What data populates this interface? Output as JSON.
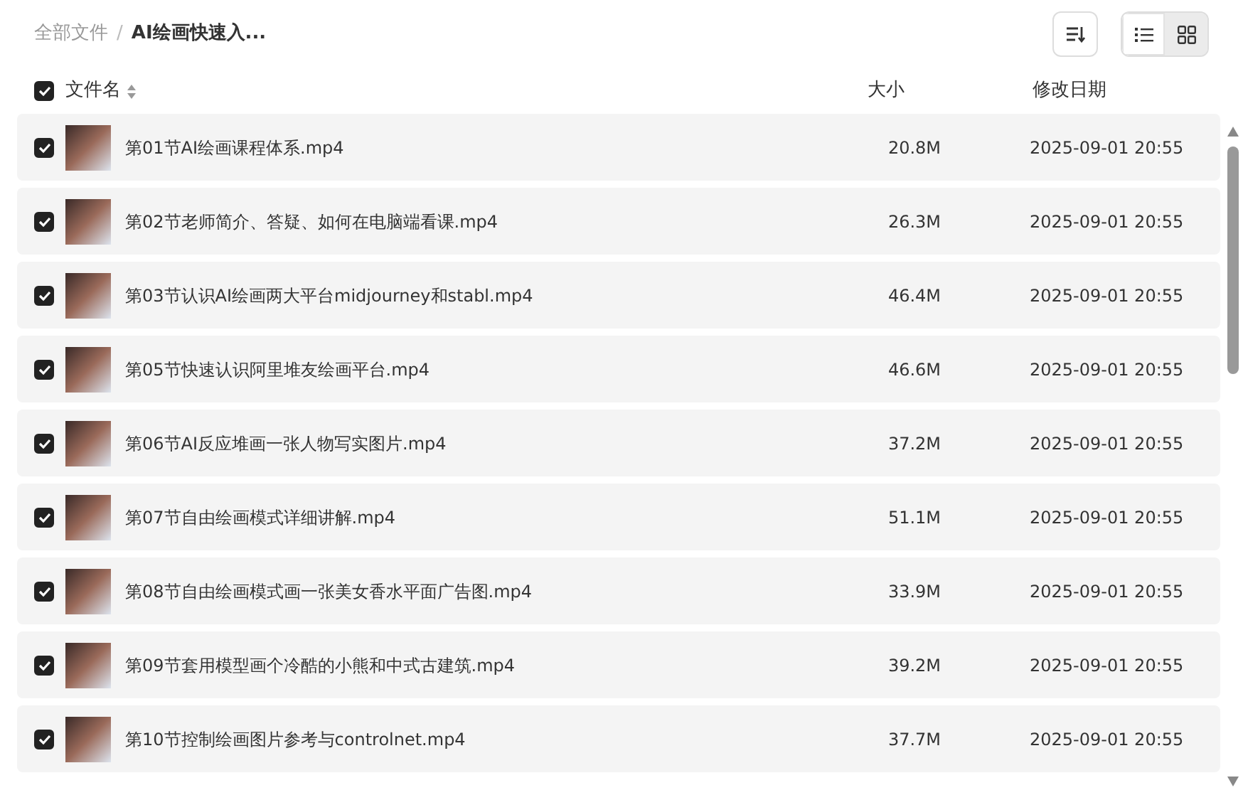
{
  "breadcrumb": [
    {
      "label": "全部文件",
      "current": false
    },
    {
      "label": "AI绘画快速入...",
      "current": true
    }
  ],
  "breadcrumb_separator": "/",
  "view_modes": [
    {
      "kind": "list",
      "selected": true
    },
    {
      "kind": "grid",
      "selected": false
    }
  ],
  "header": {
    "checked": true,
    "columns": [
      "文件名",
      "大小",
      "修改日期"
    ]
  },
  "files": [
    {
      "name": "第01节AI绘画课程体系.mp4",
      "size": "20.8M",
      "modified": "2025-09-01 20:55",
      "checked": true
    },
    {
      "name": "第02节老师简介、答疑、如何在电脑端看课.mp4",
      "size": "26.3M",
      "modified": "2025-09-01 20:55",
      "checked": true
    },
    {
      "name": "第03节认识AI绘画两大平台midjourney和stabl.mp4",
      "size": "46.4M",
      "modified": "2025-09-01 20:55",
      "checked": true
    },
    {
      "name": "第05节快速认识阿里堆友绘画平台.mp4",
      "size": "46.6M",
      "modified": "2025-09-01 20:55",
      "checked": true
    },
    {
      "name": "第06节AI反应堆画一张人物写实图片.mp4",
      "size": "37.2M",
      "modified": "2025-09-01 20:55",
      "checked": true
    },
    {
      "name": "第07节自由绘画模式详细讲解.mp4",
      "size": "51.1M",
      "modified": "2025-09-01 20:55",
      "checked": true
    },
    {
      "name": "第08节自由绘画模式画一张美女香水平面广告图.mp4",
      "size": "33.9M",
      "modified": "2025-09-01 20:55",
      "checked": true
    },
    {
      "name": "第09节套用模型画个冷酷的小熊和中式古建筑.mp4",
      "size": "39.2M",
      "modified": "2025-09-01 20:55",
      "checked": true
    },
    {
      "name": "第10节控制绘画图片参考与controlnet.mp4",
      "size": "37.7M",
      "modified": "2025-09-01 20:55",
      "checked": true
    }
  ]
}
